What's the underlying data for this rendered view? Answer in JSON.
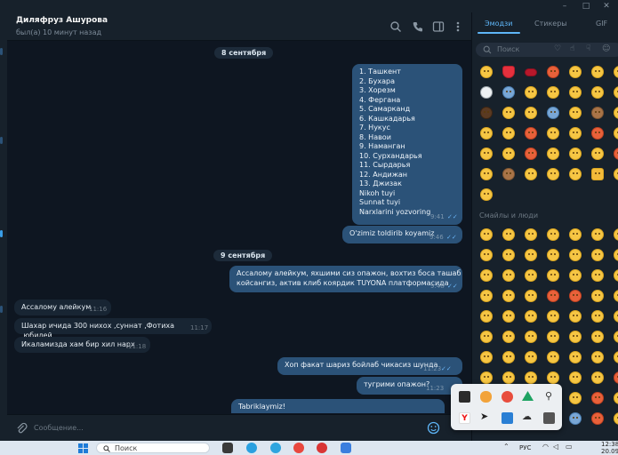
{
  "window": {
    "minimize": "–",
    "maximize": "□",
    "close": "✕"
  },
  "chat": {
    "name": "Диляфруз Ашурова",
    "status": "был(а) 10 минут назад"
  },
  "dates": {
    "d1": "8 сентября",
    "d2": "9 сентября"
  },
  "messages": {
    "list_lines": [
      "1. Ташкент",
      "2. Бухара",
      "3. Хорезм",
      "4. Фергана",
      "5. Самарканд",
      "6. Кашкадарья",
      "7. Нукус",
      "8. Навои",
      "9. Наманган",
      "10. Сурхандарья",
      "11. Сырдарья",
      "12. Андижан",
      "13. Джизак",
      "Nikoh tuyi",
      "Sunnat tuyi",
      "Narxlarini yozvoring"
    ],
    "list_time": "9:41",
    "m2": {
      "text": "O'zimiz toldirib koyamiz",
      "time": "9:46"
    },
    "m3": {
      "line1": "Ассалому алейкум, яхшими сиз опажон, вохтиз боса ташаб",
      "line2": "койсангиз, актив клиб коярдик TUYONA платформасида",
      "time": "9:48"
    },
    "m4": {
      "text": "Ассалому алейкум",
      "time": "11:16"
    },
    "m5": {
      "text": "Шахар ичида 300 нихох ,суннат ,Фотиха ,юбилей",
      "time": "11:17"
    },
    "m6": {
      "text": "Икаламизда хам бир хил нарх",
      "time": "11:18"
    },
    "m7": {
      "text": "Хоп факат шариз бойлаб чикасиз шунда",
      "time": "11:23"
    },
    "m8": {
      "text": "тугрими опажон?",
      "time": "11:23"
    },
    "m9": {
      "text": "Tabriklaymiz!"
    },
    "ticks": "✓✓"
  },
  "composer": {
    "placeholder": "Сообщение..."
  },
  "emoji_panel": {
    "tabs": [
      "Эмодзи",
      "Стикеры",
      "GIF"
    ],
    "search_placeholder": "Поиск",
    "category_title": "Смайлы и люди"
  },
  "taskbar": {
    "search_placeholder": "Поиск",
    "language": "РУС",
    "clock_time": "12:38",
    "clock_date": "20.09.2023"
  },
  "colors": {
    "accent": "#5eb5f7",
    "bubble_out": "#2b5278",
    "bubble_in": "#182533",
    "bg": "#0e1621"
  }
}
